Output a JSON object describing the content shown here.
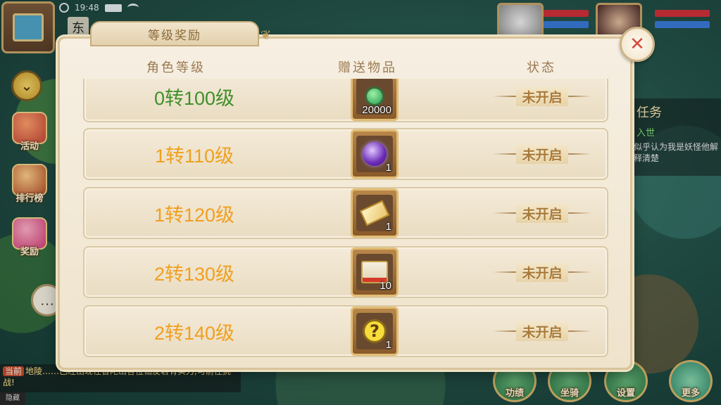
{
  "status_bar": {
    "time": "19:48"
  },
  "map": {
    "name": "东"
  },
  "side_buttons": [
    {
      "label": "活动"
    },
    {
      "label": "排行榜"
    },
    {
      "label": "奖励"
    }
  ],
  "task_panel": {
    "title": "任务",
    "subtitle": "入世",
    "text": "似乎认为我是妖怪他解释清楚"
  },
  "chat": {
    "tag": "当前",
    "message": "地陵……已经出现在普陀山各位仙友若有实力,可前往挑战!",
    "footer": "隐藏"
  },
  "bottom_buttons": [
    {
      "label": "功绩"
    },
    {
      "label": "坐骑"
    },
    {
      "label": "设置"
    },
    {
      "label": "更多"
    }
  ],
  "dialog": {
    "title": "等级奖励",
    "headers": {
      "level": "角色等级",
      "gift": "赠送物品",
      "status": "状态"
    },
    "close_icon": "close-icon",
    "rows": [
      {
        "level": "0转100级",
        "level_color": "#3f8f2a",
        "item_icon": "green-gem-icon",
        "count": "20000",
        "status": "未开启"
      },
      {
        "level": "1转110级",
        "level_color": "#f0a020",
        "item_icon": "purple-orb-icon",
        "count": "1",
        "status": "未开启"
      },
      {
        "level": "1转120级",
        "level_color": "#f0a020",
        "item_icon": "gold-scroll-icon",
        "count": "1",
        "status": "未开启"
      },
      {
        "level": "2转130级",
        "level_color": "#f0a020",
        "item_icon": "treasure-map-icon",
        "count": "10",
        "status": "未开启"
      },
      {
        "level": "2转140级",
        "level_color": "#f0a020",
        "item_icon": "question-mark-icon",
        "count": "1",
        "status": "未开启"
      }
    ]
  }
}
